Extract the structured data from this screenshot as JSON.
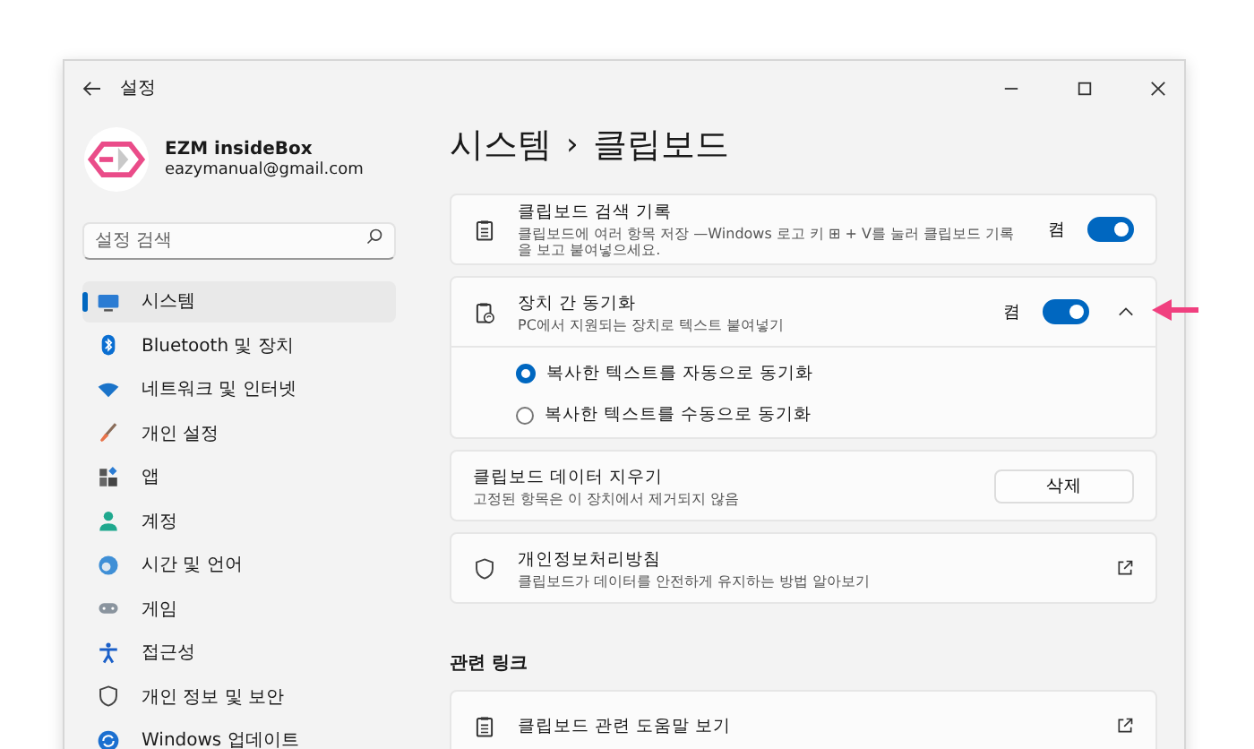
{
  "window": {
    "title": "설정"
  },
  "profile": {
    "name": "EZM insideBox",
    "email": "eazymanual@gmail.com"
  },
  "search": {
    "placeholder": "설정 검색"
  },
  "sidebar": {
    "items": [
      {
        "label": "시스템",
        "kind": "monitor",
        "selected": true
      },
      {
        "label": "Bluetooth 및 장치",
        "kind": "bluetooth",
        "selected": false
      },
      {
        "label": "네트워크 및 인터넷",
        "kind": "wifi",
        "selected": false
      },
      {
        "label": "개인 설정",
        "kind": "brush",
        "selected": false
      },
      {
        "label": "앱",
        "kind": "apps",
        "selected": false
      },
      {
        "label": "계정",
        "kind": "person",
        "selected": false
      },
      {
        "label": "시간 및 언어",
        "kind": "globe",
        "selected": false
      },
      {
        "label": "게임",
        "kind": "gamepad",
        "selected": false
      },
      {
        "label": "접근성",
        "kind": "accessibility",
        "selected": false
      },
      {
        "label": "개인 정보 및 보안",
        "kind": "shield",
        "selected": false
      },
      {
        "label": "Windows 업데이트",
        "kind": "update",
        "selected": false
      }
    ]
  },
  "breadcrumb": {
    "parent": "시스템",
    "separator": "›",
    "current": "클립보드"
  },
  "settings": [
    {
      "kind": "toggle",
      "title": "클립보드 검색 기록",
      "description": "클립보드에 여러 항목 저장 —Windows 로고 키 ⊞ + V를 눌러 클립보드 기록을 보고 붙여넣으세요.",
      "state_label": "켬",
      "on": true
    },
    {
      "kind": "expander",
      "title": "장치 간 동기화",
      "description": "PC에서 지원되는 장치로 텍스트 붙여넣기",
      "state_label": "켬",
      "on": true,
      "expanded": true,
      "options": [
        {
          "label": "복사한 텍스트를 자동으로 동기화",
          "selected": true
        },
        {
          "label": "복사한 텍스트를 수동으로 동기화",
          "selected": false
        }
      ]
    },
    {
      "kind": "button",
      "title": "클립보드 데이터 지우기",
      "description": "고정된 항목은 이 장치에서 제거되지 않음",
      "button": "삭제"
    },
    {
      "kind": "link",
      "title": "개인정보처리방침",
      "description": "클립보드가 데이터를 안전하게 유지하는 방법 알아보기"
    }
  ],
  "related": {
    "heading": "관련 링크",
    "items": [
      {
        "kind": "link",
        "title": "클립보드 관련 도움말 보기"
      }
    ]
  }
}
